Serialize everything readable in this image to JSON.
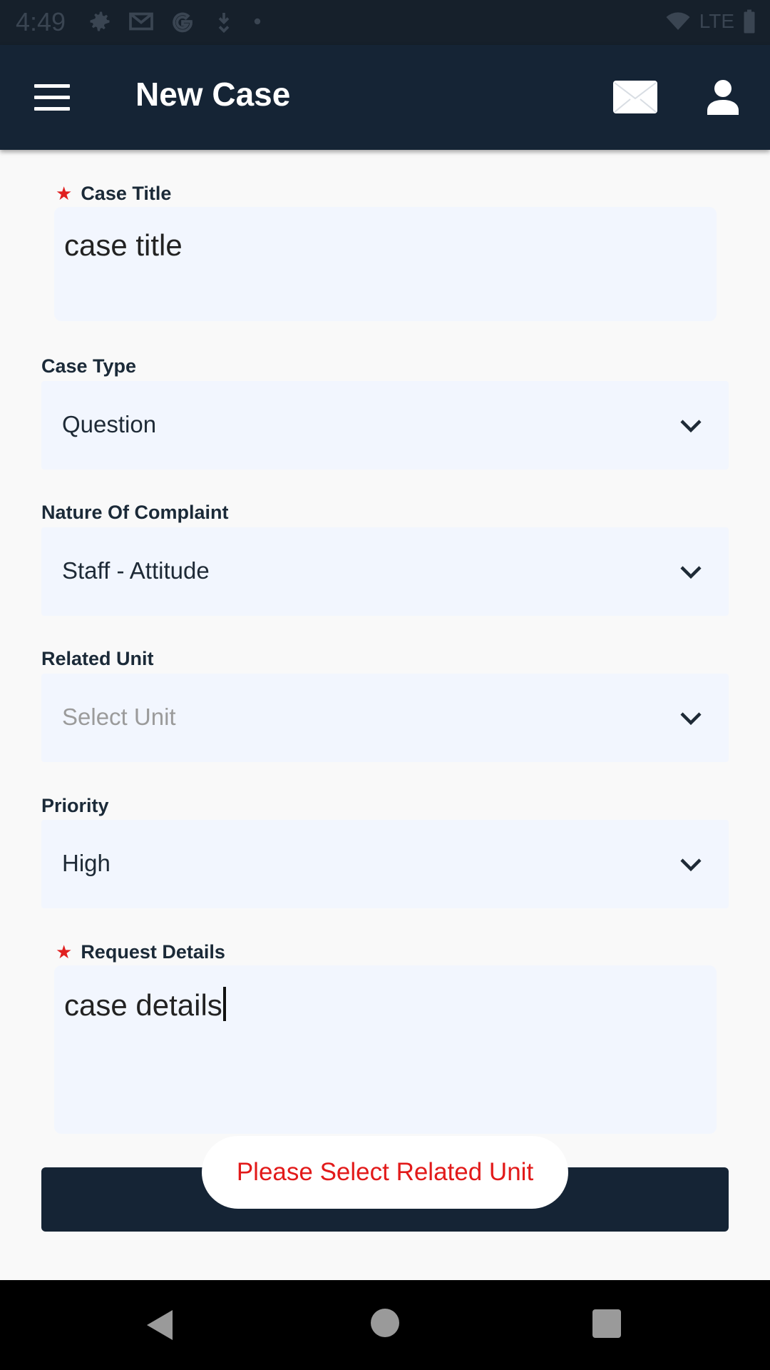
{
  "status_bar": {
    "time": "4:49",
    "icons": [
      "settings-icon",
      "gmail-icon",
      "google-icon",
      "download-icon",
      "dot-icon"
    ],
    "right_icons": [
      "wifi-off-icon",
      "signal-lte-icon",
      "battery-icon"
    ],
    "network": "LTE"
  },
  "app_bar": {
    "title": "New Case",
    "icons": [
      "menu-icon",
      "mail-icon",
      "profile-icon"
    ]
  },
  "form": {
    "case_title": {
      "label": "Case Title",
      "required_mark": "★",
      "value": "case title"
    },
    "case_type": {
      "label": "Case Type",
      "value": "Question"
    },
    "nature_of_complaint": {
      "label": "Nature Of Complaint",
      "value": "Staff - Attitude"
    },
    "related_unit": {
      "label": "Related Unit",
      "placeholder": "Select Unit"
    },
    "priority": {
      "label": "Priority",
      "value": "High"
    },
    "request_details": {
      "label": "Request Details",
      "required_mark": "★",
      "value": "case details"
    },
    "submit_label": ""
  },
  "toast": {
    "message": "Please Select Related Unit"
  },
  "colors": {
    "app_bar": "#152435",
    "field_bg": "#f2f6fe",
    "required": "#e02020",
    "toast_text": "#e21a1a"
  }
}
